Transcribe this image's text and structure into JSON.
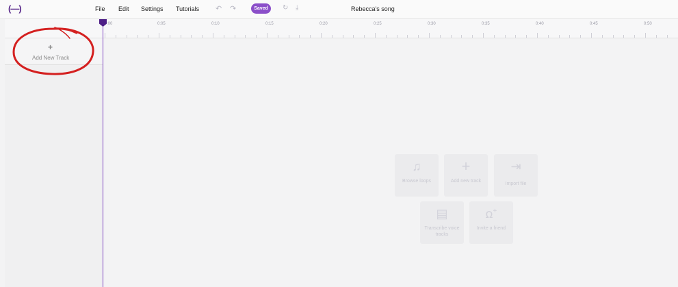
{
  "app": {
    "logo": "(—)",
    "project_title": "Rebecca's song"
  },
  "menu": [
    {
      "label": "File"
    },
    {
      "label": "Edit"
    },
    {
      "label": "Settings"
    },
    {
      "label": "Tutorials"
    }
  ],
  "toolbar": {
    "saved_label": "Saved",
    "undo_icon": "undo-icon",
    "redo_icon": "redo-icon",
    "sync_icon": "sync-icon",
    "download_icon": "download-icon"
  },
  "left_panel": {
    "add_track_label": "Add New Track",
    "add_track_icon": "plus-icon"
  },
  "timeline": {
    "ticks": [
      ":00",
      "0:05",
      "0:10",
      "0:15",
      "0:20",
      "0:25",
      "0:30",
      "0:35",
      "0:40",
      "0:45",
      "0:50"
    ]
  },
  "actions": [
    {
      "label": "Browse loops",
      "icon": "music-note-icon"
    },
    {
      "label": "Add new track",
      "icon": "plus-icon"
    },
    {
      "label": "Import file",
      "icon": "import-icon"
    },
    {
      "label": "Transcribe voice tracks",
      "icon": "document-icon"
    },
    {
      "label": "Invite a friend",
      "icon": "add-person-icon"
    }
  ],
  "colors": {
    "accent": "#8b4fc9",
    "playhead": "#7b3fc0",
    "annotation": "#d42020"
  }
}
